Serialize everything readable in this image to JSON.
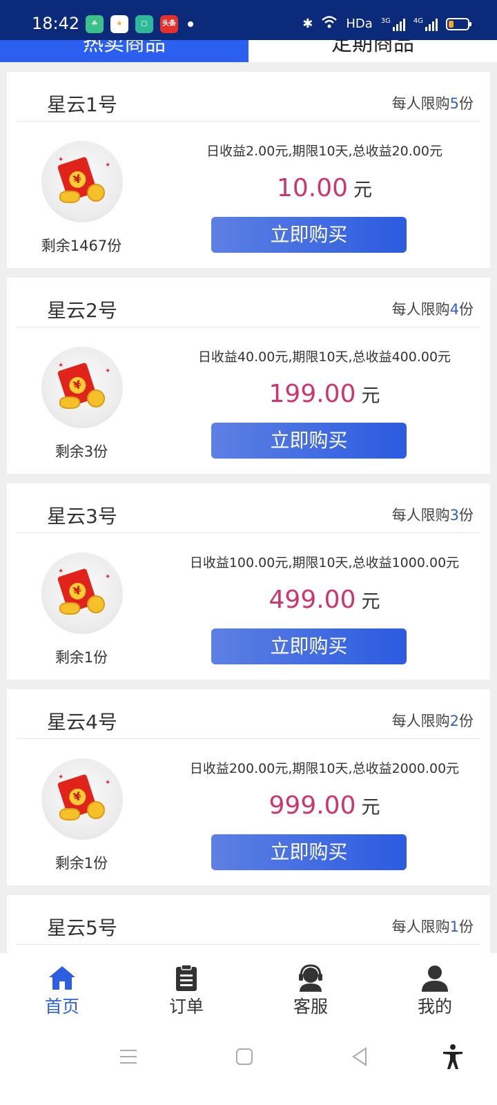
{
  "status_bar": {
    "time": "18:42",
    "apps": [
      {
        "name": "app-1-icon",
        "label": "",
        "color": "#3cc18a"
      },
      {
        "name": "app-2-icon",
        "label": "",
        "color": "#ffffff"
      },
      {
        "name": "app-3-icon",
        "label": "",
        "color": "#2fb89a"
      },
      {
        "name": "toutiao-icon",
        "label": "头条",
        "color": "#e8302b"
      }
    ],
    "network_label": "HDa",
    "signal_1_label": "3G",
    "signal_2_label": "4G"
  },
  "tabs": [
    {
      "label": "热卖商品",
      "active": true
    },
    {
      "label": "定期商品",
      "active": false
    }
  ],
  "colors": {
    "accent": "#2b5fe0",
    "price": "#d0346e",
    "status_bar": "#0b2a7a"
  },
  "products": [
    {
      "title": "星云1号",
      "limit_prefix": "每人限购",
      "limit_num": "5",
      "limit_suffix": "份",
      "desc": "日收益2.00元,期限10天,总收益20.00元",
      "price": "10.00",
      "unit": "元",
      "remain": "剩余1467份",
      "buy_label": "立即购买"
    },
    {
      "title": "星云2号",
      "limit_prefix": "每人限购",
      "limit_num": "4",
      "limit_suffix": "份",
      "desc": "日收益40.00元,期限10天,总收益400.00元",
      "price": "199.00",
      "unit": "元",
      "remain": "剩余3份",
      "buy_label": "立即购买"
    },
    {
      "title": "星云3号",
      "limit_prefix": "每人限购",
      "limit_num": "3",
      "limit_suffix": "份",
      "desc": "日收益100.00元,期限10天,总收益1000.00元",
      "price": "499.00",
      "unit": "元",
      "remain": "剩余1份",
      "buy_label": "立即购买"
    },
    {
      "title": "星云4号",
      "limit_prefix": "每人限购",
      "limit_num": "2",
      "limit_suffix": "份",
      "desc": "日收益200.00元,期限10天,总收益2000.00元",
      "price": "999.00",
      "unit": "元",
      "remain": "剩余1份",
      "buy_label": "立即购买"
    },
    {
      "title": "星云5号",
      "limit_prefix": "每人限购",
      "limit_num": "1",
      "limit_suffix": "份",
      "desc": "",
      "price": "",
      "unit": "",
      "remain": "",
      "buy_label": ""
    }
  ],
  "bottom_nav": [
    {
      "label": "首页",
      "icon": "home-icon",
      "active": true
    },
    {
      "label": "订单",
      "icon": "clipboard-icon",
      "active": false
    },
    {
      "label": "客服",
      "icon": "headset-icon",
      "active": false
    },
    {
      "label": "我的",
      "icon": "user-icon",
      "active": false
    }
  ],
  "system_nav": [
    {
      "icon": "menu-icon"
    },
    {
      "icon": "home-square-icon"
    },
    {
      "icon": "back-icon"
    },
    {
      "icon": "accessibility-icon"
    }
  ]
}
